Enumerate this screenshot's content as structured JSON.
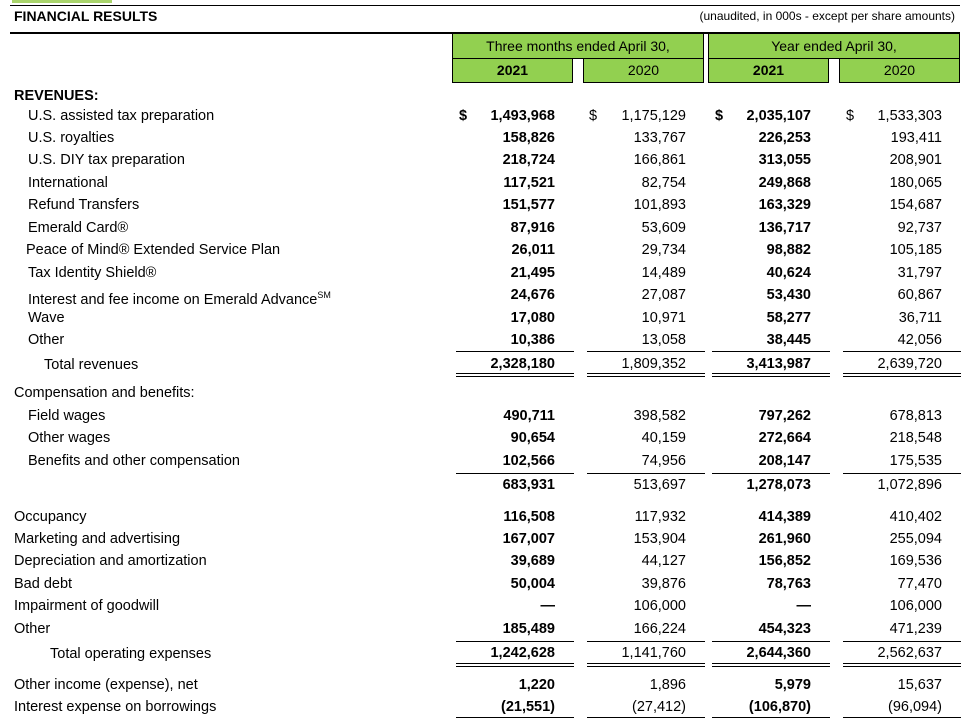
{
  "header": {
    "title": "FINANCIAL RESULTS",
    "note": "(unaudited, in 000s - except per share amounts)",
    "period_three_months": "Three months ended April 30,",
    "period_year": "Year ended April 30,",
    "years": [
      "2021",
      "2020",
      "2021",
      "2020"
    ]
  },
  "colors": {
    "header_fill": "#92d050"
  },
  "revenues_heading": "REVENUES:",
  "dollar_sign": "$",
  "revenues": [
    {
      "label": "U.S. assisted tax preparation",
      "v": [
        "1,493,968",
        "1,175,129",
        "2,035,107",
        "1,533,303"
      ]
    },
    {
      "label": "U.S. royalties",
      "v": [
        "158,826",
        "133,767",
        "226,253",
        "193,411"
      ]
    },
    {
      "label": "U.S. DIY tax preparation",
      "v": [
        "218,724",
        "166,861",
        "313,055",
        "208,901"
      ]
    },
    {
      "label": "International",
      "v": [
        "117,521",
        "82,754",
        "249,868",
        "180,065"
      ]
    },
    {
      "label": "Refund Transfers",
      "v": [
        "151,577",
        "101,893",
        "163,329",
        "154,687"
      ]
    },
    {
      "label": "Emerald Card®",
      "v": [
        "87,916",
        "53,609",
        "136,717",
        "92,737"
      ]
    },
    {
      "label": "Peace of Mind® Extended Service Plan",
      "v": [
        "26,011",
        "29,734",
        "98,882",
        "105,185"
      ]
    },
    {
      "label": "Tax Identity Shield®",
      "v": [
        "21,495",
        "14,489",
        "40,624",
        "31,797"
      ]
    },
    {
      "label": "Interest and fee income on Emerald Advance",
      "sup": "SM",
      "v": [
        "24,676",
        "27,087",
        "53,430",
        "60,867"
      ]
    },
    {
      "label": "Wave",
      "v": [
        "17,080",
        "10,971",
        "58,277",
        "36,711"
      ]
    },
    {
      "label": "Other",
      "v": [
        "10,386",
        "13,058",
        "38,445",
        "42,056"
      ]
    }
  ],
  "total_revenues": {
    "label": "Total revenues",
    "v": [
      "2,328,180",
      "1,809,352",
      "3,413,987",
      "2,639,720"
    ]
  },
  "comp_heading": "Compensation and benefits:",
  "comp": [
    {
      "label": "Field wages",
      "v": [
        "490,711",
        "398,582",
        "797,262",
        "678,813"
      ]
    },
    {
      "label": "Other wages",
      "v": [
        "90,654",
        "40,159",
        "272,664",
        "218,548"
      ]
    },
    {
      "label": "Benefits and other compensation",
      "v": [
        "102,566",
        "74,956",
        "208,147",
        "175,535"
      ]
    }
  ],
  "comp_total": {
    "v": [
      "683,931",
      "513,697",
      "1,278,073",
      "1,072,896"
    ]
  },
  "opex": [
    {
      "label": "Occupancy",
      "v": [
        "116,508",
        "117,932",
        "414,389",
        "410,402"
      ]
    },
    {
      "label": "Marketing and advertising",
      "v": [
        "167,007",
        "153,904",
        "261,960",
        "255,094"
      ]
    },
    {
      "label": "Depreciation and amortization",
      "v": [
        "39,689",
        "44,127",
        "156,852",
        "169,536"
      ]
    },
    {
      "label": "Bad debt",
      "v": [
        "50,004",
        "39,876",
        "78,763",
        "77,470"
      ]
    },
    {
      "label": "Impairment of goodwill",
      "v": [
        "—",
        "106,000",
        "—",
        "106,000"
      ]
    },
    {
      "label": "Other",
      "v": [
        "185,489",
        "166,224",
        "454,323",
        "471,239"
      ]
    }
  ],
  "total_opex": {
    "label": "Total operating expenses",
    "v": [
      "1,242,628",
      "1,141,760",
      "2,644,360",
      "2,562,637"
    ]
  },
  "other": [
    {
      "label": "Other income (expense), net",
      "v": [
        "1,220",
        "1,896",
        "5,979",
        "15,637"
      ]
    },
    {
      "label": "Interest expense on borrowings",
      "v": [
        "(21,551)",
        "(27,412)",
        "(106,870)",
        "(96,094)"
      ]
    }
  ]
}
